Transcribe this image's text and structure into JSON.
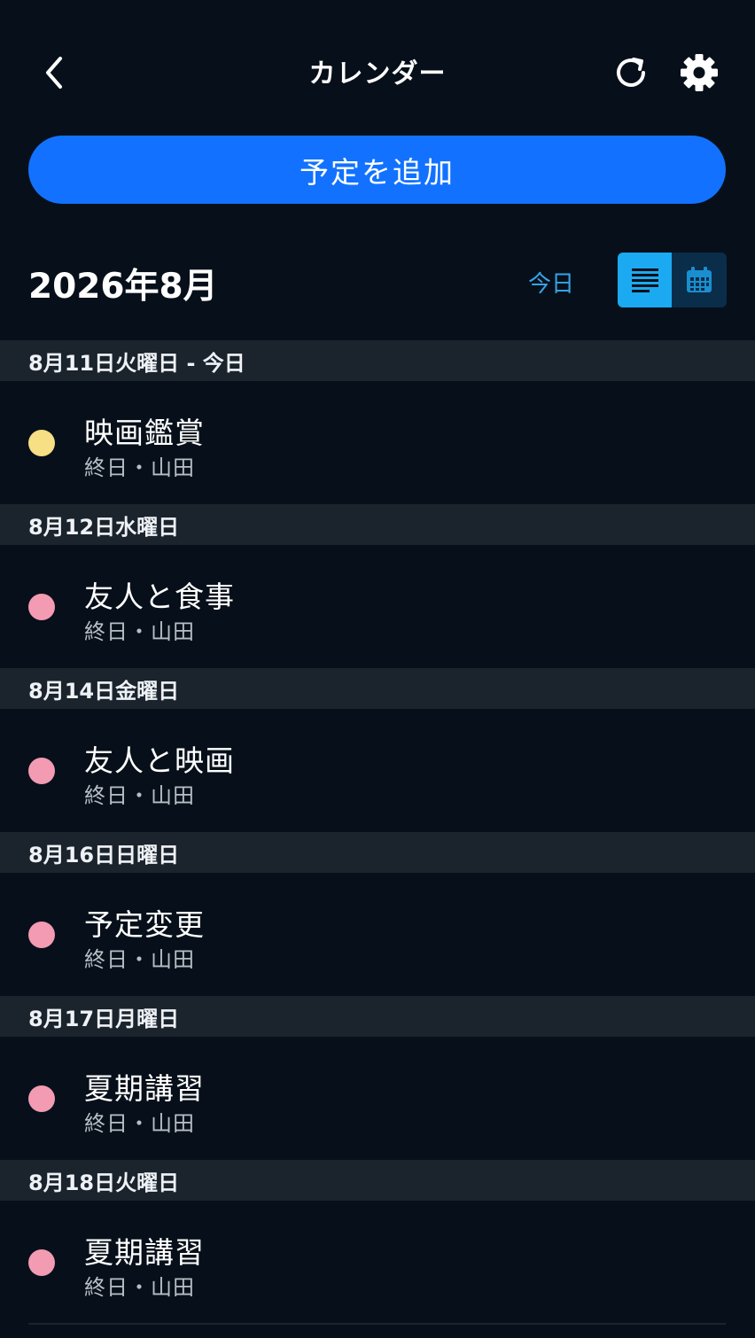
{
  "header": {
    "title": "カレンダー",
    "back_icon": "chevron-left-icon",
    "refresh_icon": "refresh-icon",
    "settings_icon": "gear-icon"
  },
  "add_button": {
    "label": "予定を追加",
    "color": "#1272ff"
  },
  "month": {
    "label": "2026年8月",
    "today_label": "今日",
    "view_modes": [
      "list",
      "calendar"
    ],
    "active_view": "list"
  },
  "events": [
    {
      "date": "8月11日火曜日 - 今日",
      "title": "映画鑑賞",
      "sub": "終日・山田",
      "color": "#f6df84"
    },
    {
      "date": "8月12日水曜日",
      "title": "友人と食事",
      "sub": "終日・山田",
      "color": "#f29bb2"
    },
    {
      "date": "8月14日金曜日",
      "title": "友人と映画",
      "sub": "終日・山田",
      "color": "#f29bb2"
    },
    {
      "date": "8月16日日曜日",
      "title": "予定変更",
      "sub": "終日・山田",
      "color": "#f29bb2"
    },
    {
      "date": "8月17日月曜日",
      "title": "夏期講習",
      "sub": "終日・山田",
      "color": "#f29bb2"
    },
    {
      "date": "8月18日火曜日",
      "title": "夏期講習",
      "sub": "終日・山田",
      "color": "#f29bb2"
    }
  ]
}
